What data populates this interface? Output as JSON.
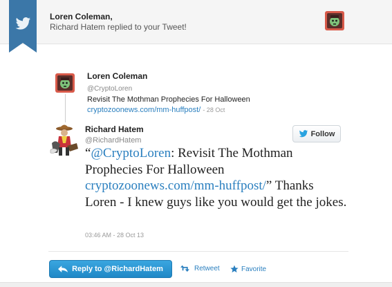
{
  "notification": {
    "title": "Loren Coleman,",
    "subtitle": "Richard Hatem replied to your Tweet!",
    "ribbon_icon": "twitter-bird-icon"
  },
  "original_tweet": {
    "author_name": "Loren Coleman",
    "handle": "@CryptoLoren",
    "text": "Revisit The Mothman Prophecies For Halloween",
    "link": "cryptozoonews.com/mm-huffpost/",
    "time": "- 28 Oct"
  },
  "reply_tweet": {
    "author_name": "Richard Hatem",
    "handle": "@RichardHatem",
    "follow_label": "Follow",
    "quote_open": "“",
    "mention": "@CryptoLoren",
    "text_part1": ": Revisit The Mothman Prophecies For Halloween ",
    "link": "cryptozoonews.com/mm-huffpost/",
    "text_part2": "” Thanks Loren - I knew guys like you would get the jokes.",
    "timestamp": "03:46 AM - 28 Oct 13"
  },
  "actions": {
    "reply_label": "Reply to @RichardHatem",
    "retweet_label": "Retweet",
    "favorite_label": "Favorite"
  },
  "colors": {
    "link": "#2a7fbf",
    "ribbon": "#3b77a8",
    "reply_button": "#2591d0"
  }
}
